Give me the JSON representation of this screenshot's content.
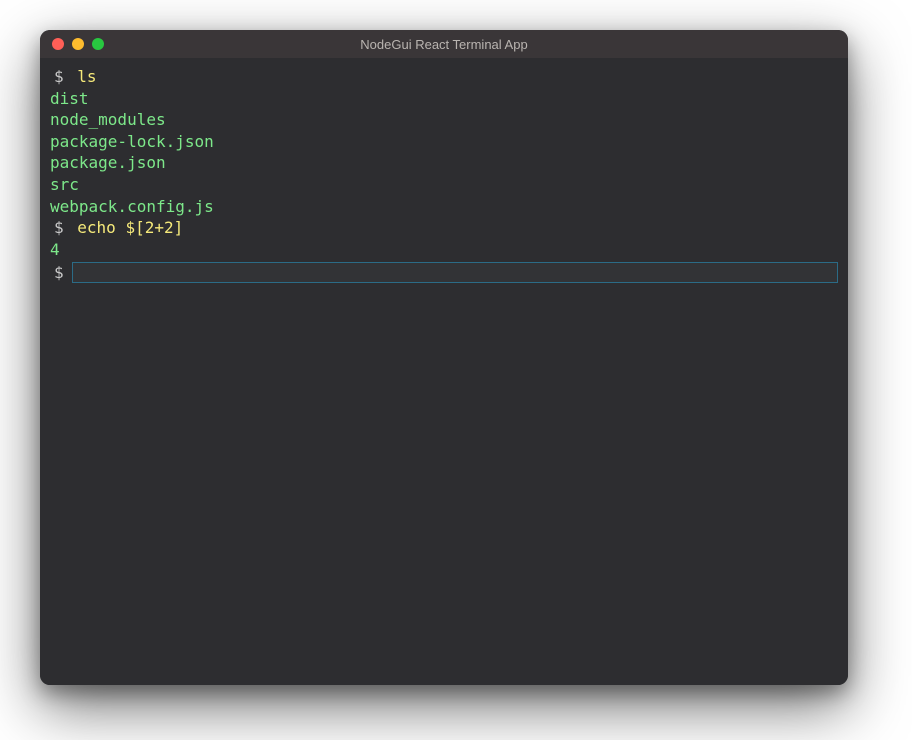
{
  "window": {
    "title": "NodeGui React Terminal App"
  },
  "terminal": {
    "prompt_char": "$",
    "history": [
      {
        "type": "command",
        "text": "ls"
      },
      {
        "type": "output",
        "text": "dist"
      },
      {
        "type": "output",
        "text": "node_modules"
      },
      {
        "type": "output",
        "text": "package-lock.json"
      },
      {
        "type": "output",
        "text": "package.json"
      },
      {
        "type": "output",
        "text": "src"
      },
      {
        "type": "output",
        "text": "webpack.config.js"
      },
      {
        "type": "command",
        "text": "echo $[2+2]"
      },
      {
        "type": "output",
        "text": "4"
      }
    ],
    "current_input": ""
  }
}
